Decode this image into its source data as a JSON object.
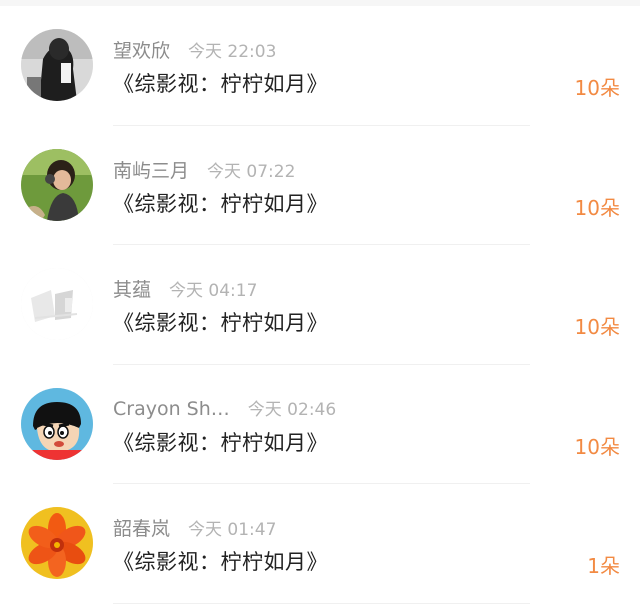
{
  "items": [
    {
      "username": "望欢欣",
      "time": "今天 22:03",
      "comment": "《综影视：柠柠如月》",
      "count": "10朵",
      "avatar": "monochrome-person-avatar"
    },
    {
      "username": "南屿三月",
      "time": "今天 07:22",
      "comment": "《综影视：柠柠如月》",
      "count": "10朵",
      "avatar": "girl-with-headphones-avatar"
    },
    {
      "username": "其蕴",
      "time": "今天 04:17",
      "comment": "《综影视：柠柠如月》",
      "count": "10朵",
      "avatar": "faded-sketch-avatar"
    },
    {
      "username": "Crayon Sh…",
      "time": "今天 02:46",
      "comment": "《综影视：柠柠如月》",
      "count": "10朵",
      "avatar": "cartoon-boy-avatar"
    },
    {
      "username": "韶春岚",
      "time": "今天 01:47",
      "comment": "《综影视：柠柠如月》",
      "count": "1朵",
      "avatar": "orange-flower-avatar"
    }
  ],
  "colors": {
    "count": "#f28a43",
    "username": "#8c8c8c",
    "time": "#b3b3b3",
    "comment": "#222222"
  }
}
